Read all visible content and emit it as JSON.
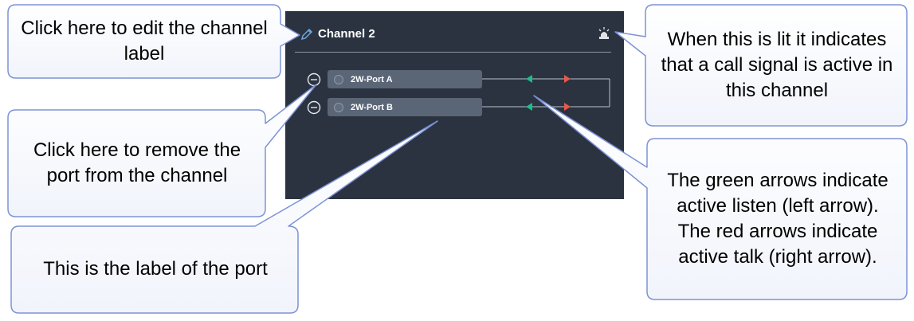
{
  "panel": {
    "title": "Channel 2",
    "ports": [
      {
        "label": "2W-Port A"
      },
      {
        "label": "2W-Port B"
      }
    ],
    "icons": {
      "edit": "pencil-icon",
      "call_signal": "call-signal-light-icon",
      "remove": "minus-circle-icon",
      "listen": "left-arrow-icon",
      "talk": "right-arrow-icon"
    },
    "colors": {
      "panel_bg": "#2c3340",
      "listen_arrow": "#19c08a",
      "talk_arrow": "#e9594a"
    }
  },
  "callouts": {
    "edit_label": "Click here to edit the channel label",
    "remove_port": "Click here to remove the port from the channel",
    "port_label": "This is the label of the port",
    "call_signal": "When this is lit it indicates that a call signal is active in this channel",
    "arrows": "The green arrows indicate active listen (left arrow). The red arrows indicate active talk (right arrow)."
  }
}
